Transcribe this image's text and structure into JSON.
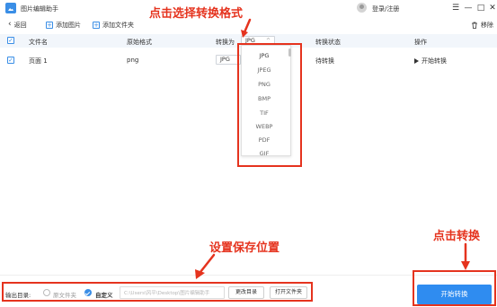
{
  "app": {
    "title": "图片编辑助手",
    "login_label": "登录/注册",
    "window_controls": [
      "menu-icon",
      "minimize-icon",
      "maximize-icon",
      "close-icon"
    ]
  },
  "toolbar": {
    "back_label": "返回",
    "add_image_label": "添加图片",
    "add_folder_label": "添加文件夹",
    "remove_label": "移除"
  },
  "table": {
    "headers": {
      "filename": "文件名",
      "original_format": "原始格式",
      "convert_to": "转换为",
      "status": "转换状态",
      "action": "操作"
    },
    "header_select_value": "JPG",
    "rows": [
      {
        "filename": "页面 1",
        "original_format": "png",
        "convert_to": "JPG",
        "status": "待转换",
        "action_label": "开始转换"
      }
    ]
  },
  "format_dropdown": {
    "options": [
      "JPG",
      "JPEG",
      "PNG",
      "BMP",
      "TIF",
      "WEBP",
      "PDF",
      "GIF"
    ],
    "selected": "JPG"
  },
  "output": {
    "label": "输出目录:",
    "option_source": "原文件夹",
    "option_custom": "自定义",
    "selected_option": "自定义",
    "path_value": "C:\\Users\\风平\\Desktop\\图片编辑助手",
    "change_dir_label": "更改目录",
    "open_folder_label": "打开文件夹"
  },
  "start_button_label": "开始转换",
  "annotations": {
    "select_format": "点击选择转换格式",
    "set_save_location": "设置保存位置",
    "click_convert": "点击转换"
  },
  "colors": {
    "accent": "#3a8ee6",
    "primary_button": "#2f8cf0",
    "annotation_red": "#e5331e",
    "header_bg": "#f2f6fb"
  }
}
